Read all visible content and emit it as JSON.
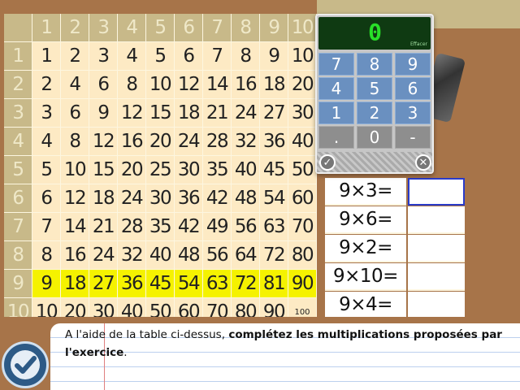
{
  "table": {
    "header": [
      "1",
      "2",
      "3",
      "4",
      "5",
      "6",
      "7",
      "8",
      "9",
      "10"
    ],
    "rows": [
      [
        "1",
        "2",
        "3",
        "4",
        "5",
        "6",
        "7",
        "8",
        "9",
        "10"
      ],
      [
        "2",
        "4",
        "6",
        "8",
        "10",
        "12",
        "14",
        "16",
        "18",
        "20"
      ],
      [
        "3",
        "6",
        "9",
        "12",
        "15",
        "18",
        "21",
        "24",
        "27",
        "30"
      ],
      [
        "4",
        "8",
        "12",
        "16",
        "20",
        "24",
        "28",
        "32",
        "36",
        "40"
      ],
      [
        "5",
        "10",
        "15",
        "20",
        "25",
        "30",
        "35",
        "40",
        "45",
        "50"
      ],
      [
        "6",
        "12",
        "18",
        "24",
        "30",
        "36",
        "42",
        "48",
        "54",
        "60"
      ],
      [
        "7",
        "14",
        "21",
        "28",
        "35",
        "42",
        "49",
        "56",
        "63",
        "70"
      ],
      [
        "8",
        "16",
        "24",
        "32",
        "40",
        "48",
        "56",
        "64",
        "72",
        "80"
      ],
      [
        "9",
        "18",
        "27",
        "36",
        "45",
        "54",
        "63",
        "72",
        "81",
        "90"
      ],
      [
        "10",
        "20",
        "30",
        "40",
        "50",
        "60",
        "70",
        "80",
        "90",
        "100"
      ]
    ],
    "highlight_row": 9,
    "highlight_color": "#f5f200"
  },
  "calculator": {
    "display": "0",
    "erase_label": "Effacer",
    "keys": [
      "7",
      "8",
      "9",
      "4",
      "5",
      "6",
      "1",
      "2",
      "3",
      ".",
      "0",
      "-"
    ],
    "ok_icon": "check-circle-icon",
    "close_icon": "x-circle-icon"
  },
  "exercise": {
    "questions": [
      "9×3=",
      "9×6=",
      "9×2=",
      "9×10=",
      "9×4="
    ],
    "answers": [
      "",
      "",
      "",
      "",
      ""
    ],
    "active_index": 0,
    "active_color": "#2a3bc8"
  },
  "instruction": {
    "text_plain": "A l'aide de la table ci-dessus, ",
    "text_bold": "complétez les multiplications proposées par l'exercice",
    "text_end": "."
  },
  "validate_icon": "check-circle-icon"
}
